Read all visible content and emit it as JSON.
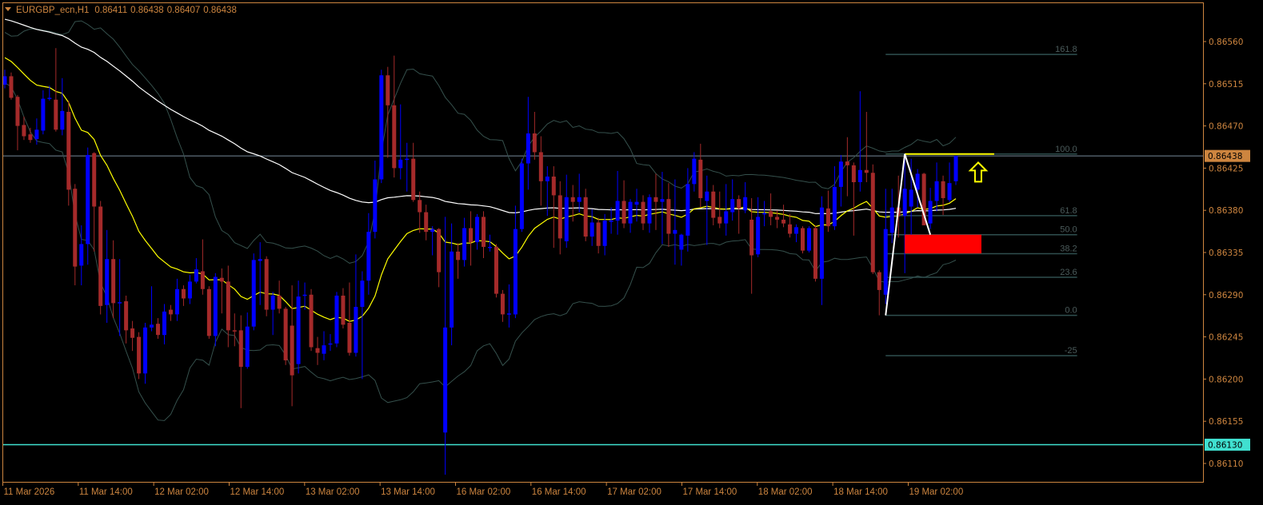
{
  "header": {
    "symbol": "EURGBP_ecn,H1",
    "open": "0.86411",
    "high": "0.86438",
    "low": "0.86407",
    "close": "0.86438"
  },
  "colors": {
    "background": "#000000",
    "axis": "#cd853f",
    "bull": "#0000ff",
    "bear": "#a52a2a",
    "ema_fast": "#ffff00",
    "ema_slow": "#ffffff",
    "bands": "#35504c",
    "bid_line": "#778899",
    "support_line": "#40e0d0",
    "fib": "#2f4f4f",
    "zone": "#ff0000",
    "arrow": "#ffff00",
    "zigzag": "#ffffff"
  },
  "chart_data": {
    "type": "candlestick",
    "title": "EURGBP_ecn,H1",
    "price_base": 0.86,
    "point": 1e-05,
    "ylim": [
      0.86091,
      0.86602
    ],
    "ohlc_points": [
      [
        514,
        530,
        510,
        523
      ],
      [
        523,
        527,
        498,
        500
      ],
      [
        501,
        503,
        444,
        470
      ],
      [
        471,
        480,
        455,
        459
      ],
      [
        461,
        468,
        452,
        455
      ],
      [
        456,
        478,
        450,
        466
      ],
      [
        465,
        508,
        461,
        499
      ],
      [
        499,
        513,
        497,
        500
      ],
      [
        498,
        553,
        464,
        466
      ],
      [
        466,
        521,
        460,
        486
      ],
      [
        485,
        497,
        385,
        402
      ],
      [
        403,
        408,
        300,
        320
      ],
      [
        321,
        364,
        300,
        344
      ],
      [
        344,
        447,
        322,
        439
      ],
      [
        441,
        442,
        336,
        384
      ],
      [
        384,
        390,
        269,
        278
      ],
      [
        279,
        359,
        260,
        328
      ],
      [
        328,
        348,
        265,
        281
      ],
      [
        281,
        328,
        246,
        282
      ],
      [
        283,
        289,
        238,
        252
      ],
      [
        254,
        262,
        230,
        244
      ],
      [
        245,
        250,
        200,
        206
      ],
      [
        206,
        260,
        195,
        255
      ],
      [
        255,
        299,
        251,
        258
      ],
      [
        259,
        265,
        243,
        247
      ],
      [
        247,
        280,
        237,
        272
      ],
      [
        274,
        279,
        262,
        269
      ],
      [
        269,
        307,
        262,
        296
      ],
      [
        296,
        300,
        278,
        286
      ],
      [
        286,
        311,
        280,
        304
      ],
      [
        304,
        329,
        302,
        317
      ],
      [
        315,
        349,
        290,
        296
      ],
      [
        296,
        299,
        243,
        246
      ],
      [
        246,
        313,
        235,
        309
      ],
      [
        308,
        318,
        270,
        304
      ],
      [
        304,
        321,
        234,
        252
      ],
      [
        252,
        270,
        235,
        251
      ],
      [
        252,
        268,
        169,
        213
      ],
      [
        213,
        271,
        211,
        256
      ],
      [
        256,
        334,
        252,
        327
      ],
      [
        326,
        346,
        279,
        328
      ],
      [
        328,
        331,
        267,
        274
      ],
      [
        274,
        293,
        247,
        289
      ],
      [
        289,
        305,
        270,
        275
      ],
      [
        275,
        277,
        215,
        220
      ],
      [
        257,
        300,
        171,
        204
      ],
      [
        216,
        305,
        206,
        288
      ],
      [
        290,
        303,
        274,
        290
      ],
      [
        290,
        296,
        230,
        234
      ],
      [
        233,
        245,
        215,
        228
      ],
      [
        227,
        251,
        220,
        236
      ],
      [
        237,
        248,
        230,
        238
      ],
      [
        238,
        293,
        234,
        289
      ],
      [
        289,
        297,
        254,
        258
      ],
      [
        260,
        303,
        225,
        228
      ],
      [
        228,
        333,
        224,
        277
      ],
      [
        277,
        315,
        200,
        305
      ],
      [
        305,
        377,
        290,
        357
      ],
      [
        357,
        433,
        350,
        413
      ],
      [
        413,
        530,
        409,
        524
      ],
      [
        524,
        533,
        436,
        492
      ],
      [
        492,
        545,
        415,
        425
      ],
      [
        425,
        493,
        413,
        434
      ],
      [
        434,
        452,
        400,
        435
      ],
      [
        435,
        452,
        389,
        391
      ],
      [
        391,
        400,
        356,
        378
      ],
      [
        378,
        386,
        348,
        357
      ],
      [
        357,
        363,
        332,
        360
      ],
      [
        360,
        361,
        298,
        314
      ],
      [
        143,
        373,
        98,
        255
      ],
      [
        255,
        366,
        236,
        336
      ],
      [
        336,
        345,
        307,
        327
      ],
      [
        327,
        372,
        320,
        361
      ],
      [
        361,
        379,
        321,
        346
      ],
      [
        346,
        376,
        338,
        373
      ],
      [
        373,
        379,
        329,
        341
      ],
      [
        341,
        354,
        336,
        341
      ],
      [
        341,
        344,
        287,
        291
      ],
      [
        291,
        295,
        261,
        269
      ],
      [
        269,
        301,
        255,
        270
      ],
      [
        269,
        385,
        265,
        360
      ],
      [
        360,
        435,
        357,
        430
      ],
      [
        430,
        501,
        402,
        462
      ],
      [
        462,
        485,
        434,
        442
      ],
      [
        442,
        459,
        385,
        411
      ],
      [
        411,
        427,
        374,
        416
      ],
      [
        416,
        427,
        340,
        396
      ],
      [
        396,
        411,
        333,
        350
      ],
      [
        347,
        418,
        340,
        394
      ],
      [
        394,
        407,
        368,
        389
      ],
      [
        389,
        419,
        378,
        394
      ],
      [
        394,
        403,
        347,
        352
      ],
      [
        352,
        381,
        342,
        367
      ],
      [
        367,
        372,
        334,
        342
      ],
      [
        342,
        376,
        332,
        369
      ],
      [
        369,
        383,
        355,
        369
      ],
      [
        369,
        422,
        354,
        390
      ],
      [
        390,
        412,
        361,
        366
      ],
      [
        366,
        392,
        356,
        389
      ],
      [
        386,
        403,
        368,
        389
      ],
      [
        389,
        396,
        359,
        366
      ],
      [
        366,
        397,
        356,
        394
      ],
      [
        394,
        419,
        359,
        389
      ],
      [
        389,
        421,
        344,
        392
      ],
      [
        392,
        409,
        341,
        355
      ],
      [
        355,
        413,
        322,
        359
      ],
      [
        338,
        355,
        321,
        354
      ],
      [
        353,
        425,
        336,
        408
      ],
      [
        408,
        442,
        400,
        435
      ],
      [
        434,
        451,
        383,
        393
      ],
      [
        390,
        417,
        343,
        400
      ],
      [
        400,
        407,
        364,
        372
      ],
      [
        373,
        400,
        361,
        366
      ],
      [
        366,
        408,
        353,
        379
      ],
      [
        378,
        413,
        369,
        392
      ],
      [
        392,
        396,
        355,
        382
      ],
      [
        380,
        410,
        377,
        394
      ],
      [
        370,
        393,
        291,
        332
      ],
      [
        333,
        394,
        330,
        373
      ],
      [
        377,
        390,
        363,
        377
      ],
      [
        379,
        398,
        364,
        373
      ],
      [
        373,
        380,
        361,
        370
      ],
      [
        370,
        386,
        362,
        366
      ],
      [
        365,
        376,
        351,
        355
      ],
      [
        355,
        365,
        346,
        362
      ],
      [
        361,
        363,
        334,
        337
      ],
      [
        337,
        363,
        335,
        361
      ],
      [
        361,
        364,
        304,
        307
      ],
      [
        307,
        395,
        279,
        383
      ],
      [
        382,
        401,
        357,
        363
      ],
      [
        363,
        427,
        359,
        405
      ],
      [
        405,
        439,
        384,
        432
      ],
      [
        432,
        458,
        395,
        428
      ],
      [
        428,
        431,
        353,
        410
      ],
      [
        410,
        507,
        400,
        423
      ],
      [
        423,
        485,
        410,
        420
      ],
      [
        420,
        429,
        312,
        314
      ],
      [
        314,
        316,
        268,
        295
      ],
      [
        290,
        403,
        280,
        360
      ],
      [
        356,
        403,
        345,
        383
      ],
      [
        383,
        417,
        351,
        374
      ],
      [
        374,
        440,
        313,
        403
      ],
      [
        384,
        435,
        351,
        402
      ],
      [
        402,
        424,
        383,
        419
      ],
      [
        419,
        420,
        364,
        364
      ],
      [
        366,
        404,
        360,
        390
      ],
      [
        390,
        431,
        379,
        411
      ],
      [
        411,
        417,
        375,
        393
      ],
      [
        391,
        431,
        389,
        409
      ],
      [
        411,
        438,
        407,
        438
      ]
    ],
    "y_ticks": [
      "0.86560",
      "0.86515",
      "0.86470",
      "0.86425",
      "0.86380",
      "0.86335",
      "0.86290",
      "0.86245",
      "0.86200",
      "0.86155",
      "0.86110"
    ],
    "x_ticks": [
      "11 Mar 2026",
      "11 Mar 14:00",
      "12 Mar 02:00",
      "12 Mar 14:00",
      "13 Mar 02:00",
      "13 Mar 14:00",
      "16 Mar 02:00",
      "16 Mar 14:00",
      "17 Mar 02:00",
      "17 Mar 14:00",
      "18 Mar 02:00",
      "18 Mar 14:00",
      "19 Mar 02:00"
    ],
    "bid_line": {
      "price": 0.86438,
      "label": "0.86438"
    },
    "horizontal_line": {
      "price": 0.8613,
      "label": "0.86130"
    },
    "indicators": {
      "ema_fast": {
        "period": 20,
        "seed": 0.86545
      },
      "ema_slow": {
        "period": 100,
        "seed": 0.86585
      },
      "bands": {
        "period": 20,
        "deviations": 2
      }
    },
    "fibonacci": {
      "price_0": 0.86268,
      "price_100": 0.8644,
      "start_bar": 138,
      "end_bar": 168,
      "levels": [
        {
          "ratio": 161.8,
          "label": "161.8"
        },
        {
          "ratio": 100,
          "label": "100.0"
        },
        {
          "ratio": 61.8,
          "label": "61.8"
        },
        {
          "ratio": 50,
          "label": "50.0"
        },
        {
          "ratio": 38.2,
          "label": "38.2"
        },
        {
          "ratio": 23.6,
          "label": "23.6"
        },
        {
          "ratio": 0,
          "label": "0.0"
        },
        {
          "ratio": -25,
          "label": "-25"
        }
      ]
    },
    "zigzag": [
      [
        138,
        0.86268
      ],
      [
        141,
        0.8644
      ],
      [
        145,
        0.86354
      ]
    ],
    "zone": {
      "from_bar": 141,
      "to_bar": 153,
      "price_top": 0.86354,
      "price_bottom": 0.86334
    },
    "resistance_segment": {
      "from_bar": 141,
      "to_bar": 155,
      "price": 0.8644
    },
    "signal_arrow": {
      "bar": 152.5,
      "direction": "up",
      "price": 0.86431
    }
  }
}
